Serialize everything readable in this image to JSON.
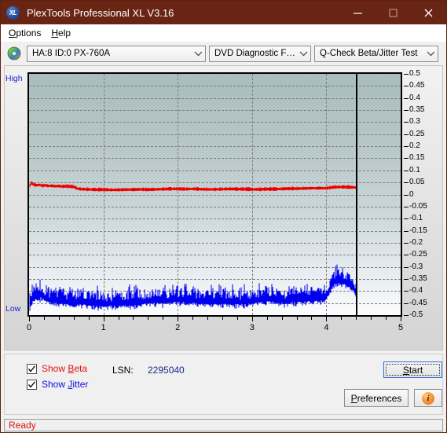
{
  "window": {
    "title": "PlexTools Professional XL V3.16",
    "app_icon": "xl-disc-icon",
    "minimize": "minimize-icon",
    "maximize": "maximize-icon",
    "close": "close-icon",
    "titlebar_color": "#6a2414"
  },
  "menubar": {
    "items": [
      {
        "label": "Options",
        "accel": "O"
      },
      {
        "label": "Help",
        "accel": "H"
      }
    ]
  },
  "toolbar": {
    "drive_icon": "optical-disc-icon",
    "drive": {
      "value": "HA:8 ID:0  PX-760A"
    },
    "function": {
      "value": "DVD Diagnostic Functions"
    },
    "test": {
      "value": "Q-Check Beta/Jitter Test"
    }
  },
  "controls": {
    "show_beta": {
      "label": "Show Beta",
      "accel": "B",
      "checked": true,
      "color": "#e01010"
    },
    "show_jitter": {
      "label": "Show Jitter",
      "accel": "J",
      "checked": true,
      "color": "#1010e0"
    },
    "lsn_label": "LSN:",
    "lsn_value": "2295040",
    "start_button": {
      "label": "Start",
      "accel": "S"
    },
    "preferences_button": {
      "label": "Preferences",
      "accel": "P"
    },
    "info_button": {
      "label": "i",
      "icon": "info-icon"
    }
  },
  "statusbar": {
    "text": "Ready",
    "color": "#e01010"
  },
  "chart_data": {
    "type": "line",
    "title": "Q-Check Beta/Jitter Test",
    "xlabel": "",
    "ylabel": "",
    "xlim": [
      0,
      5
    ],
    "ylim": [
      -0.5,
      0.5
    ],
    "grid": true,
    "legend_position": "below-left",
    "left_axis_labels": {
      "top": "High",
      "bottom": "Low"
    },
    "x_ticks": [
      "0",
      "1",
      "2",
      "3",
      "4",
      "5"
    ],
    "x_tick_values": [
      0,
      1,
      2,
      3,
      4,
      5
    ],
    "y_ticks": [
      "0.5",
      "0.45",
      "0.4",
      "0.35",
      "0.3",
      "0.25",
      "0.2",
      "0.15",
      "0.1",
      "0.05",
      "0",
      "-0.05",
      "-0.1",
      "-0.15",
      "-0.2",
      "-0.25",
      "-0.3",
      "-0.35",
      "-0.4",
      "-0.45",
      "-0.5"
    ],
    "y_tick_values": [
      0.5,
      0.45,
      0.4,
      0.35,
      0.3,
      0.25,
      0.2,
      0.15,
      0.1,
      0.05,
      0,
      -0.05,
      -0.1,
      -0.15,
      -0.2,
      -0.25,
      -0.3,
      -0.35,
      -0.4,
      -0.45,
      -0.5
    ],
    "data_end_x": 4.4,
    "series": [
      {
        "name": "Beta",
        "color": "#ee0000",
        "x": [
          0.0,
          0.03,
          0.06,
          0.1,
          0.14,
          0.18,
          0.22,
          0.26,
          0.3,
          0.35,
          0.4,
          0.45,
          0.5,
          0.55,
          0.6,
          0.65,
          0.7,
          0.8,
          0.9,
          1.0,
          1.1,
          1.2,
          1.3,
          1.4,
          1.5,
          1.6,
          1.7,
          1.8,
          1.9,
          2.0,
          2.1,
          2.2,
          2.3,
          2.4,
          2.5,
          2.6,
          2.7,
          2.8,
          2.9,
          3.0,
          3.1,
          3.2,
          3.3,
          3.4,
          3.5,
          3.6,
          3.7,
          3.8,
          3.9,
          4.0,
          4.1,
          4.2,
          4.3,
          4.4
        ],
        "values": [
          0.03,
          0.048,
          0.041,
          0.038,
          0.04,
          0.036,
          0.038,
          0.035,
          0.036,
          0.034,
          0.035,
          0.033,
          0.034,
          0.033,
          0.032,
          0.024,
          0.022,
          0.021,
          0.02,
          0.02,
          0.019,
          0.019,
          0.02,
          0.02,
          0.021,
          0.02,
          0.021,
          0.022,
          0.023,
          0.023,
          0.022,
          0.023,
          0.022,
          0.021,
          0.021,
          0.022,
          0.023,
          0.022,
          0.022,
          0.021,
          0.021,
          0.022,
          0.022,
          0.023,
          0.024,
          0.024,
          0.025,
          0.026,
          0.026,
          0.026,
          0.03,
          0.031,
          0.03,
          0.029
        ],
        "noise": 0.006
      },
      {
        "name": "Jitter",
        "color": "#0000ee",
        "x": [
          0.0,
          0.05,
          0.1,
          0.15,
          0.2,
          0.25,
          0.3,
          0.35,
          0.4,
          0.45,
          0.5,
          0.55,
          0.6,
          0.65,
          0.7,
          0.75,
          0.8,
          0.9,
          1.0,
          1.1,
          1.2,
          1.3,
          1.4,
          1.5,
          1.6,
          1.7,
          1.8,
          1.9,
          2.0,
          2.1,
          2.2,
          2.3,
          2.4,
          2.5,
          2.6,
          2.7,
          2.8,
          2.9,
          3.0,
          3.1,
          3.2,
          3.3,
          3.4,
          3.5,
          3.6,
          3.7,
          3.8,
          3.9,
          4.0,
          4.05,
          4.1,
          4.15,
          4.2,
          4.25,
          4.3,
          4.35,
          4.4
        ],
        "values": [
          -0.47,
          -0.438,
          -0.43,
          -0.424,
          -0.432,
          -0.44,
          -0.448,
          -0.447,
          -0.449,
          -0.45,
          -0.452,
          -0.455,
          -0.456,
          -0.455,
          -0.454,
          -0.456,
          -0.457,
          -0.46,
          -0.461,
          -0.46,
          -0.459,
          -0.458,
          -0.456,
          -0.452,
          -0.45,
          -0.448,
          -0.447,
          -0.445,
          -0.444,
          -0.446,
          -0.447,
          -0.448,
          -0.45,
          -0.452,
          -0.452,
          -0.453,
          -0.454,
          -0.452,
          -0.45,
          -0.444,
          -0.44,
          -0.444,
          -0.448,
          -0.446,
          -0.444,
          -0.442,
          -0.44,
          -0.438,
          -0.432,
          -0.4,
          -0.372,
          -0.36,
          -0.366,
          -0.37,
          -0.374,
          -0.39,
          -0.412
        ],
        "band": 0.055
      }
    ]
  }
}
